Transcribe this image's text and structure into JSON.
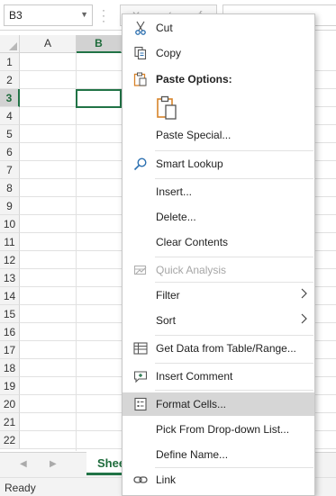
{
  "namebox": {
    "value": "B3"
  },
  "columns": [
    "A",
    "B"
  ],
  "selected_column": "B",
  "rows": [
    "1",
    "2",
    "3",
    "4",
    "5",
    "6",
    "7",
    "8",
    "9",
    "10",
    "11",
    "12",
    "13",
    "14",
    "15",
    "16",
    "17",
    "18",
    "19",
    "20",
    "21",
    "22"
  ],
  "selected_row": "3",
  "sheet_tab": {
    "label": "Shee"
  },
  "status": {
    "text": "Ready"
  },
  "menu": {
    "cut": "Cut",
    "copy": "Copy",
    "paste_options": "Paste Options:",
    "paste_special": "Paste Special...",
    "smart_lookup": "Smart Lookup",
    "insert": "Insert...",
    "delete": "Delete...",
    "clear_contents": "Clear Contents",
    "quick_analysis": "Quick Analysis",
    "filter": "Filter",
    "sort": "Sort",
    "get_data": "Get Data from Table/Range...",
    "insert_comment": "Insert Comment",
    "format_cells": "Format Cells...",
    "pick_from_list": "Pick From Drop-down List...",
    "define_name": "Define Name...",
    "link": "Link"
  },
  "colors": {
    "accent": "#217346",
    "menu_highlight": "#d6d6d6",
    "icon_blue": "#2a6fb0",
    "icon_orange": "#d7832a"
  }
}
